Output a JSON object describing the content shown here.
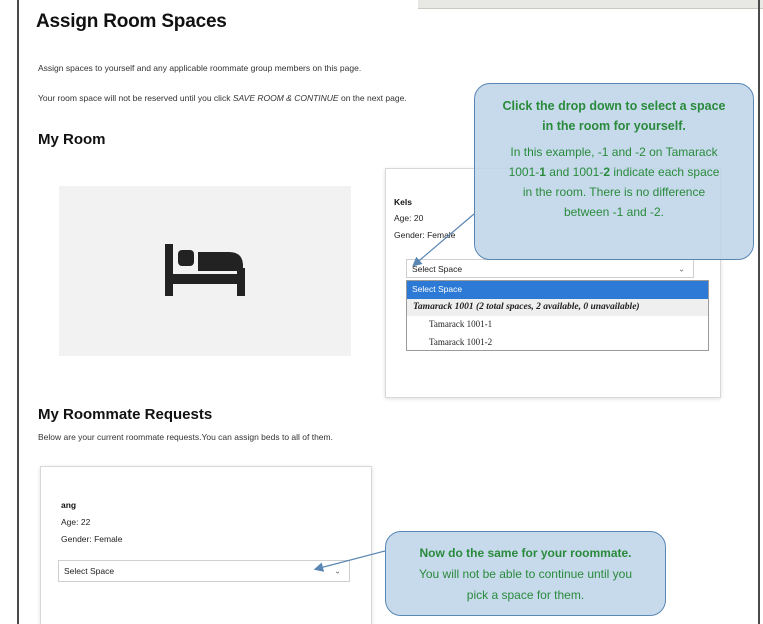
{
  "page": {
    "title": "Assign Room Spaces",
    "intro_line1": "Assign spaces to yourself and any applicable roommate group members on this page.",
    "intro_line2_pre": "Your room space will not be reserved until you click ",
    "intro_line2_em": "SAVE ROOM & CONTINUE",
    "intro_line2_post": " on the next page."
  },
  "my_room": {
    "heading": "My Room",
    "icon": "bed-icon",
    "person": {
      "name": "Kels",
      "age": "Age: 20",
      "gender": "Gender: Female"
    },
    "select_value": "Select Space",
    "dropdown": {
      "selected": "Select Space",
      "group": "Tamarack 1001 (2 total spaces, 2 available, 0 unavailable)",
      "options": [
        "Tamarack 1001-1",
        "Tamarack 1001-2"
      ]
    }
  },
  "roommate_requests": {
    "heading": "My Roommate Requests",
    "description": "Below are your current roommate requests.You can assign beds to all of them.",
    "person": {
      "name": "ang",
      "age": "Age: 22",
      "gender": "Gender: Female"
    },
    "select_value": "Select Space"
  },
  "callouts": {
    "first": {
      "heading_line1": "Click the drop down to select a space",
      "heading_line2": "in the room for yourself.",
      "body_line1": "In this example, -1 and -2 on Tamarack",
      "body_line2_a": "1001-",
      "body_line2_b": "1",
      "body_line2_c": " and 1001-",
      "body_line2_d": "2",
      "body_line2_e": " indicate each space",
      "body_line3": "in the room.  There is no difference",
      "body_line4": "between -1 and -2."
    },
    "second": {
      "heading": "Now do the same for your roommate.",
      "body_line1": "You will not be able to continue until you",
      "body_line2": "pick a space for them."
    }
  },
  "colors": {
    "callout_text": "#2a8a3c",
    "callout_fill": "#bdd4e8",
    "callout_border": "#5a86b3",
    "selected_option": "#2d7ad6"
  }
}
